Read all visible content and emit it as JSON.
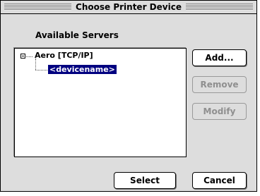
{
  "window": {
    "title": "Choose Printer Device"
  },
  "servers": {
    "label": "Available Servers",
    "tree": [
      {
        "name": "Aero [TCP/IP]",
        "expanded": true,
        "children": [
          {
            "name": "<devicename>",
            "selected": true
          }
        ]
      }
    ]
  },
  "buttons": {
    "add": "Add...",
    "remove": "Remove",
    "modify": "Modify",
    "select": "Select",
    "cancel": "Cancel"
  },
  "colors": {
    "selection_bg": "#000080",
    "selection_fg": "#ffffff",
    "window_bg": "#dddddd",
    "disabled_text": "#8f8f8f"
  }
}
